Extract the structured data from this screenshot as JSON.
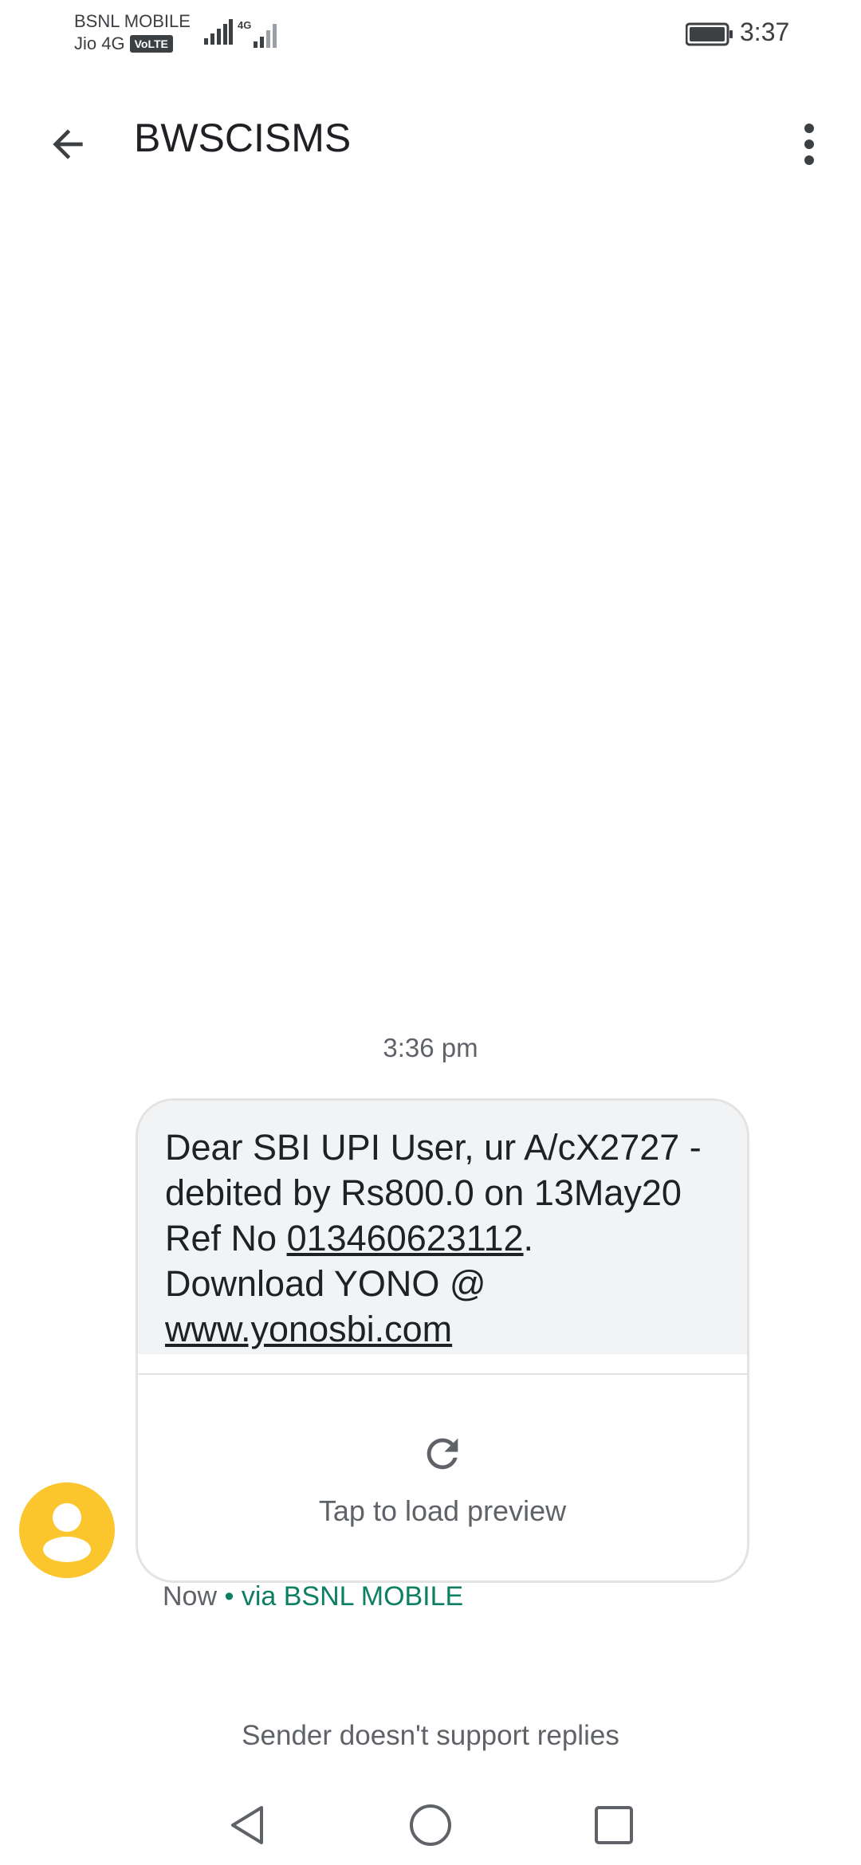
{
  "status_bar": {
    "carrier_primary": "BSNL MOBILE",
    "carrier_secondary": "Jio 4G",
    "volte_badge": "VoLTE",
    "network_type": "4G",
    "time": "3:37",
    "icons": [
      "signal-icon",
      "signal-4g-icon",
      "battery-icon"
    ]
  },
  "app_bar": {
    "title": "BWSCISMS",
    "back_icon": "arrow-back-icon",
    "menu_icon": "more-vert-icon"
  },
  "conversation": {
    "timestamp": "3:36 pm",
    "message": {
      "line1": "Dear SBI UPI User, ur A/cX2727 -",
      "line2": "debited by Rs800.0 on 13May20",
      "ref_prefix": "Ref No ",
      "ref_number": "013460623112",
      "ref_suffix": ".",
      "line4": "Download YONO @",
      "url": "www.yonosbi.com"
    },
    "preview": {
      "label": "Tap to load preview",
      "icon": "refresh-icon"
    },
    "meta": {
      "time": "Now",
      "separator": " • ",
      "via": "via BSNL MOBILE"
    },
    "footer_notice": "Sender doesn't support replies"
  },
  "colors": {
    "bubble_background": "#f1f3f4",
    "avatar": "#fbc52e",
    "via_text": "#0d7f62"
  },
  "nav_bar": {
    "icons": [
      "nav-back-icon",
      "nav-home-icon",
      "nav-recents-icon"
    ]
  }
}
